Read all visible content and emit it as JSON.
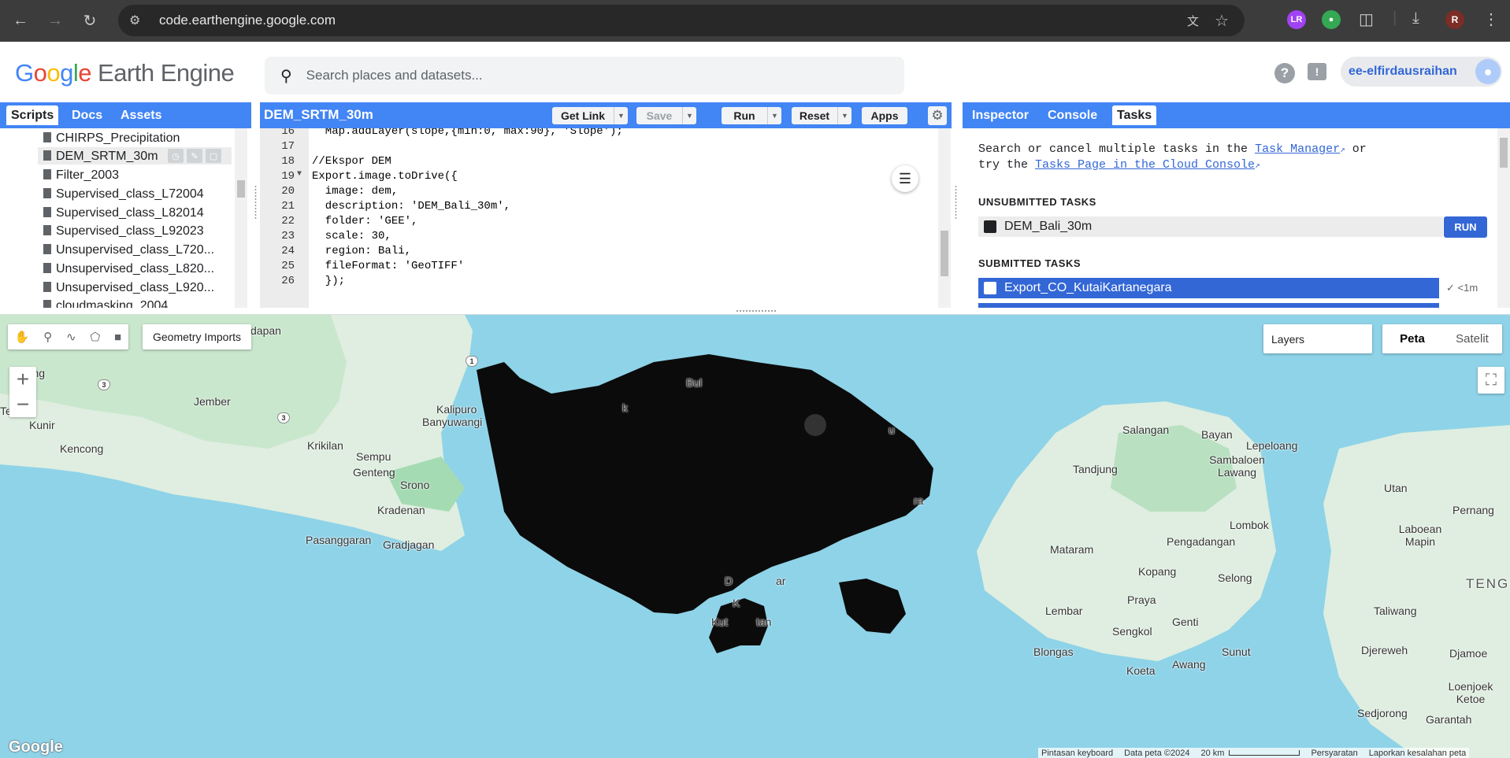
{
  "browser": {
    "url": "code.earthengine.google.com",
    "profile_initial": "R",
    "extension_initial": "LR"
  },
  "header": {
    "logo_google": "Google",
    "logo_product": "Earth Engine",
    "search_placeholder": "Search places and datasets...",
    "help_glyph": "?",
    "account_name": "ee-elfirdausraihan"
  },
  "left_panel": {
    "tabs": [
      "Scripts",
      "Docs",
      "Assets"
    ],
    "active_tab": "Scripts",
    "scripts": [
      "CHIRPS_Precipitation",
      "DEM_SRTM_30m",
      "Filter_2003",
      "Supervised_class_L72004",
      "Supervised_class_L82014",
      "Supervised_class_L92023",
      "Unsupervised_class_L720...",
      "Unsupervised_class_L820...",
      "Unsupervised_class_L920...",
      "cloudmasking_2004"
    ],
    "selected_script": "DEM_SRTM_30m"
  },
  "editor": {
    "title": "DEM_SRTM_30m",
    "buttons": {
      "get_link": "Get Link",
      "save": "Save",
      "run": "Run",
      "reset": "Reset",
      "apps": "Apps"
    },
    "lines": [
      {
        "n": "16",
        "text": "  Map.addLayer(slope,{min:0, max:90}, 'Slope');"
      },
      {
        "n": "17",
        "text": ""
      },
      {
        "n": "18",
        "text": "//Ekspor DEM"
      },
      {
        "n": "19",
        "text": "Export.image.toDrive({"
      },
      {
        "n": "20",
        "text": "  image: dem,"
      },
      {
        "n": "21",
        "text": "  description: 'DEM_Bali_30m',"
      },
      {
        "n": "22",
        "text": "  folder: 'GEE',"
      },
      {
        "n": "23",
        "text": "  scale: 30,"
      },
      {
        "n": "24",
        "text": "  region: Bali,"
      },
      {
        "n": "25",
        "text": "  fileFormat: 'GeoTIFF'"
      },
      {
        "n": "26",
        "text": "  });"
      }
    ]
  },
  "right_panel": {
    "tabs": [
      "Inspector",
      "Console",
      "Tasks"
    ],
    "active_tab": "Tasks",
    "intro_1": "Search or cancel multiple tasks in the ",
    "link_task_manager": "Task Manager",
    "intro_or": " or",
    "intro_2": "try the ",
    "link_cloud_console": "Tasks Page in the Cloud Console",
    "unsubmitted_heading": "UNSUBMITTED TASKS",
    "unsubmitted_task": "DEM_Bali_30m",
    "run_label": "RUN",
    "submitted_heading": "SUBMITTED TASKS",
    "submitted_task": "Export_CO_KutaiKartanegara",
    "submitted_time": "<1m"
  },
  "map": {
    "geometry_imports": "Geometry Imports",
    "layers": "Layers",
    "maptype_map": "Peta",
    "maptype_satellite": "Satelit",
    "watermark": "Google",
    "attribution": {
      "shortcuts": "Pintasan keyboard",
      "data": "Data peta ©2024",
      "scale": "20 km",
      "terms": "Persyaratan",
      "report": "Laporkan kesalahan peta"
    },
    "labels": [
      "dapan",
      "hajang",
      "Jember",
      "Te",
      "Kunir",
      "Kencong",
      "Krikilan",
      "Sempu",
      "Genteng",
      "Srono",
      "Kradenan",
      "Pasanggaran",
      "Gradjagan",
      "Kalipuro",
      "Banyuwangi",
      "Bul",
      "Salangan",
      "Bayan",
      "Lepeloang",
      "Tandjung",
      "Sambaloen Lawang",
      "Utan",
      "Pernang",
      "Lombok",
      "Laboean Mapin",
      "Mataram",
      "Pengadangan",
      "Kopang",
      "Selong",
      "Praya",
      "Lembar",
      "Sengkol",
      "Genti",
      "Taliwang",
      "Blongas",
      "Sunut",
      "Koeta",
      "Awang",
      "Djereweh",
      "Djamoe",
      "Loenjoek Ketoe",
      "Sedjorong",
      "Garantah",
      "TENGG",
      "D",
      "ar",
      "K",
      "Kut",
      "tan",
      "u",
      "ra",
      "k"
    ],
    "road_numbers": [
      "1",
      "3",
      "3"
    ]
  }
}
